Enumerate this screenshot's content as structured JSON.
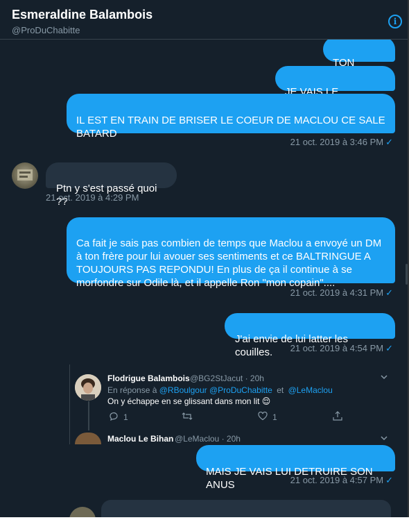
{
  "header": {
    "name": "Esmeraldine Balambois",
    "handle": "@ProDuChabitte",
    "info_symbol": "i"
  },
  "messages": {
    "m1": "TON FRERE",
    "m2": "JE VAIS LE DEFONCER",
    "m3": "IL EST EN TRAIN DE BRISER LE COEUR DE MACLOU CE SALE BATARD",
    "ts1": "21 oct. 2019 à 3:46 PM",
    "r1": "Ptn y s'est passé quoi ??",
    "ts2": "21 oct. 2019 à 4:29 PM",
    "m4": "Ca fait je sais pas combien de temps que Maclou a envoyé un DM à ton frère pour lui avouer ses sentiments et ce BALTRINGUE A TOUJOURS PAS REPONDU! En plus de ça il continue à se morfondre sur Odile là, et il appelle Ron \"mon copain\"....",
    "ts3": "21 oct. 2019 à 4:31 PM",
    "m5": "J'ai envie de lui latter les couilles.",
    "ts4": "21 oct. 2019 à 4:54 PM",
    "m6": "MAIS JE VAIS LUI DETRUIRE SON ANUS",
    "ts5": "21 oct. 2019 à 4:57 PM",
    "check": "✓"
  },
  "tweet1": {
    "name": "Flodrigue Balambois",
    "handle": "@BG2StJacut",
    "sep": "·",
    "time": "20h",
    "reply_prefix": "En réponse à",
    "reply_user1": "@RBoulgour",
    "reply_user2": "@ProDuChabitte",
    "reply_and": "et",
    "reply_user3": "@LeMaclou",
    "text": "On y échappe en se glissant dans mon lit 😌",
    "replies": "1",
    "likes": "1"
  },
  "tweet2": {
    "name": "Maclou Le Bihan",
    "handle": "@LeMaclou",
    "sep": "·",
    "time": "20h"
  },
  "colors": {
    "background": "#15202b",
    "sent_bubble": "#1da1f2",
    "received_bubble": "#253341",
    "secondary_text": "#8899a6"
  }
}
